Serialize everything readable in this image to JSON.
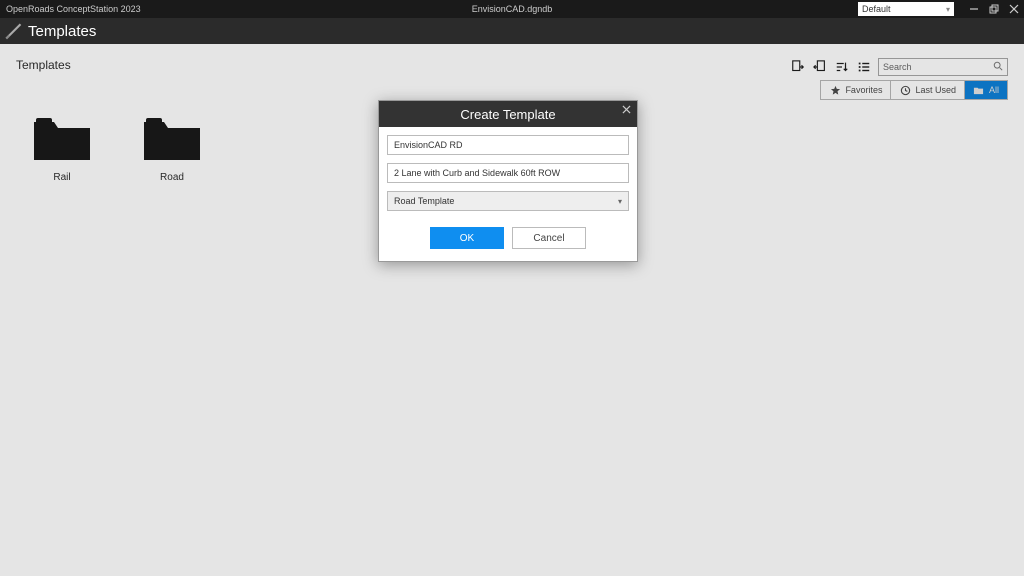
{
  "titlebar": {
    "app_name": "OpenRoads ConceptStation 2023",
    "file_name": "EnvisionCAD.dgndb",
    "workspace": "Default"
  },
  "ribbon": {
    "title": "Templates"
  },
  "page": {
    "title": "Templates"
  },
  "search": {
    "placeholder": "Search"
  },
  "filters": {
    "favorites": "Favorites",
    "last_used": "Last Used",
    "all": "All"
  },
  "folders": [
    {
      "label": "Rail"
    },
    {
      "label": "Road"
    }
  ],
  "modal": {
    "title": "Create Template",
    "field_name": "EnvisionCAD RD",
    "field_desc": "2 Lane with Curb and Sidewalk 60ft ROW",
    "type_selected": "Road Template",
    "ok": "OK",
    "cancel": "Cancel"
  }
}
